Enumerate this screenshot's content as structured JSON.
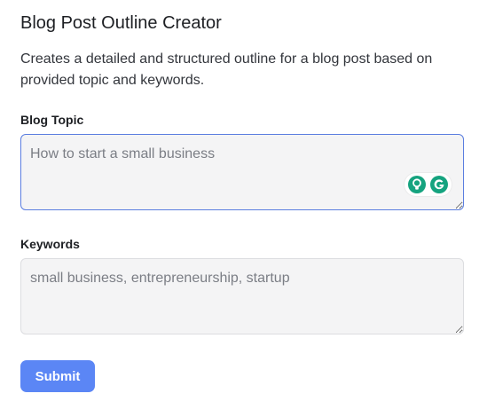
{
  "header": {
    "title": "Blog Post Outline Creator",
    "description": "Creates a detailed and structured outline for a blog post based on provided topic and keywords."
  },
  "form": {
    "topic": {
      "label": "Blog Topic",
      "placeholder": "How to start a small business",
      "value": ""
    },
    "keywords": {
      "label": "Keywords",
      "placeholder": "small business, entrepreneurship, startup",
      "value": ""
    },
    "submit_label": "Submit"
  },
  "extension_icons": [
    "lightbulb-icon",
    "grammarly-icon"
  ],
  "colors": {
    "accent": "#5b86f5",
    "focus_border": "#5b7ee0",
    "field_background": "#f4f4f5",
    "extension_green": "#15a37f"
  }
}
